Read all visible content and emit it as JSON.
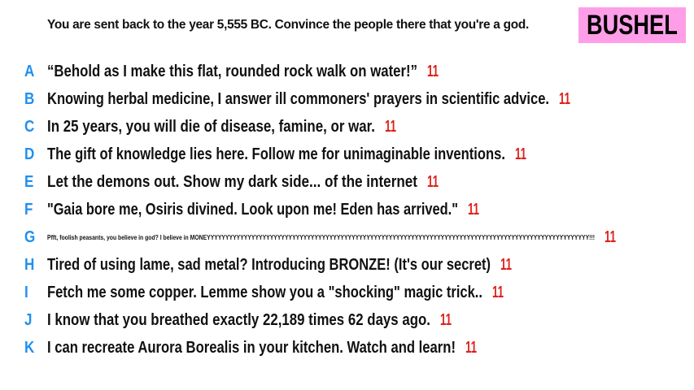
{
  "prompt": "You are sent back to the year 5,555 BC. Convince the people there that you're a god.",
  "badge": "BUSHEL",
  "answers": [
    {
      "letter": "A",
      "text": "“Behold as I make this flat, rounded rock walk on water!”",
      "score": "11"
    },
    {
      "letter": "B",
      "text": "Knowing herbal medicine, I answer ill commoners' prayers in scientific advice.",
      "score": "11"
    },
    {
      "letter": "C",
      "text": "In 25 years, you will die of disease, famine, or war.",
      "score": "11"
    },
    {
      "letter": "D",
      "text": "The gift of knowledge lies here. Follow me for unimaginable inventions.",
      "score": "11"
    },
    {
      "letter": "E",
      "text": "Let the demons out. Show my dark side... of the internet",
      "score": "11"
    },
    {
      "letter": "F",
      "text": "\"Gaia bore me, Osiris divined. Look upon me! Eden has arrived.\"",
      "score": "11"
    },
    {
      "letter": "G",
      "text": "Pfft, foolish peasants, you believe in god? I believe in MONEYYYYYYYYYYYYYYYYYYYYYYYYYYYYYYYYYYYYYYYYYYYYYYYYYYYYYYYYYYYYYYYYYYYYYYYYYYYYYYYYYYYYYYYYYYYYYYYYYYYYYYY!!!",
      "score": "11"
    },
    {
      "letter": "H",
      "text": "Tired of using lame, sad metal? Introducing BRONZE! (It's our secret)",
      "score": "11"
    },
    {
      "letter": "I",
      "text": "Fetch me some copper. Lemme show you a \"shocking\" magic trick..",
      "score": "11"
    },
    {
      "letter": "J",
      "text": "I know that you breathed exactly 22,189 times 62 days ago.",
      "score": "11"
    },
    {
      "letter": "K",
      "text": "I can recreate Aurora Borealis in your kitchen. Watch and learn!",
      "score": "11"
    }
  ]
}
